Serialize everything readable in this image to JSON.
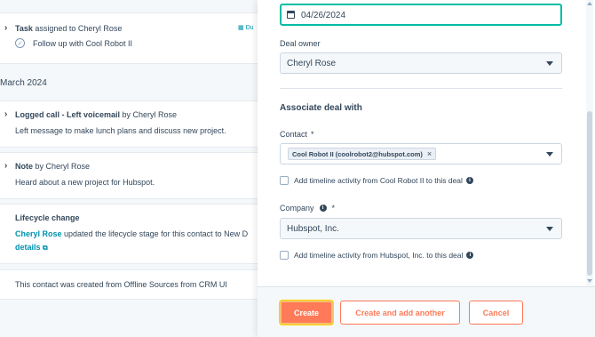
{
  "timeline": {
    "task": {
      "label": "Task",
      "rest": " assigned to Cheryl Rose",
      "due": "Du",
      "subtask": "Follow up with Cool Robot II"
    },
    "month_header": "March 2024",
    "call": {
      "title": "Logged call - Left voicemail",
      "by": " by Cheryl Rose",
      "body": "Left message to make lunch plans and discuss new project."
    },
    "note": {
      "title": "Note",
      "by": " by Cheryl Rose",
      "body": "Heard about a new project for Hubspot."
    },
    "lifecycle": {
      "title": "Lifecycle change",
      "owner": "Cheryl Rose",
      "body": " updated the lifecycle stage for this contact to New D",
      "details": "details"
    },
    "created": "This contact was created from Offline Sources from CRM UI"
  },
  "panel": {
    "close_date": "04/26/2024",
    "deal_owner_label": "Deal owner",
    "deal_owner_value": "Cheryl Rose",
    "associate_title": "Associate deal with",
    "contact_label": "Contact",
    "required_mark": "*",
    "contact_tag": "Cool Robot II (coolrobot2@hubspot.com)",
    "contact_checkbox": "Add timeline activity from Cool Robot II to this deal",
    "company_label": "Company",
    "company_value": "Hubspot, Inc.",
    "company_checkbox": "Add timeline activity from Hubspot, Inc. to this deal"
  },
  "footer": {
    "create": "Create",
    "create_another": "Create and add another",
    "cancel": "Cancel"
  },
  "colors": {
    "accent": "#ff7a59",
    "focus": "#00bda5",
    "link": "#0091ae",
    "text": "#33475b"
  }
}
